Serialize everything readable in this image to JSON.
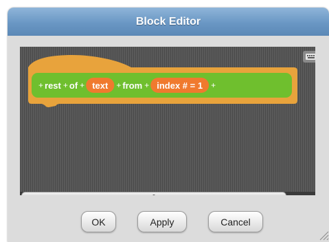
{
  "window": {
    "title": "Block Editor"
  },
  "block": {
    "parts": [
      {
        "type": "plus",
        "text": "+"
      },
      {
        "type": "label",
        "text": "rest"
      },
      {
        "type": "plus",
        "text": "+"
      },
      {
        "type": "label",
        "text": "of"
      },
      {
        "type": "plus",
        "text": "+"
      },
      {
        "type": "input",
        "text": "text"
      },
      {
        "type": "plus",
        "text": "+"
      },
      {
        "type": "label",
        "text": "from"
      },
      {
        "type": "plus",
        "text": "+"
      },
      {
        "type": "input",
        "text": "index # = 1"
      },
      {
        "type": "plus",
        "text": "+"
      }
    ],
    "colors": {
      "hat": "#e8a33c",
      "body": "#6fbf2e",
      "input": "#f07a2e"
    }
  },
  "buttons": {
    "ok": "OK",
    "apply": "Apply",
    "cancel": "Cancel"
  },
  "icons": {
    "keyboard": "keyboard-icon",
    "resize": "resize-grip-icon"
  }
}
